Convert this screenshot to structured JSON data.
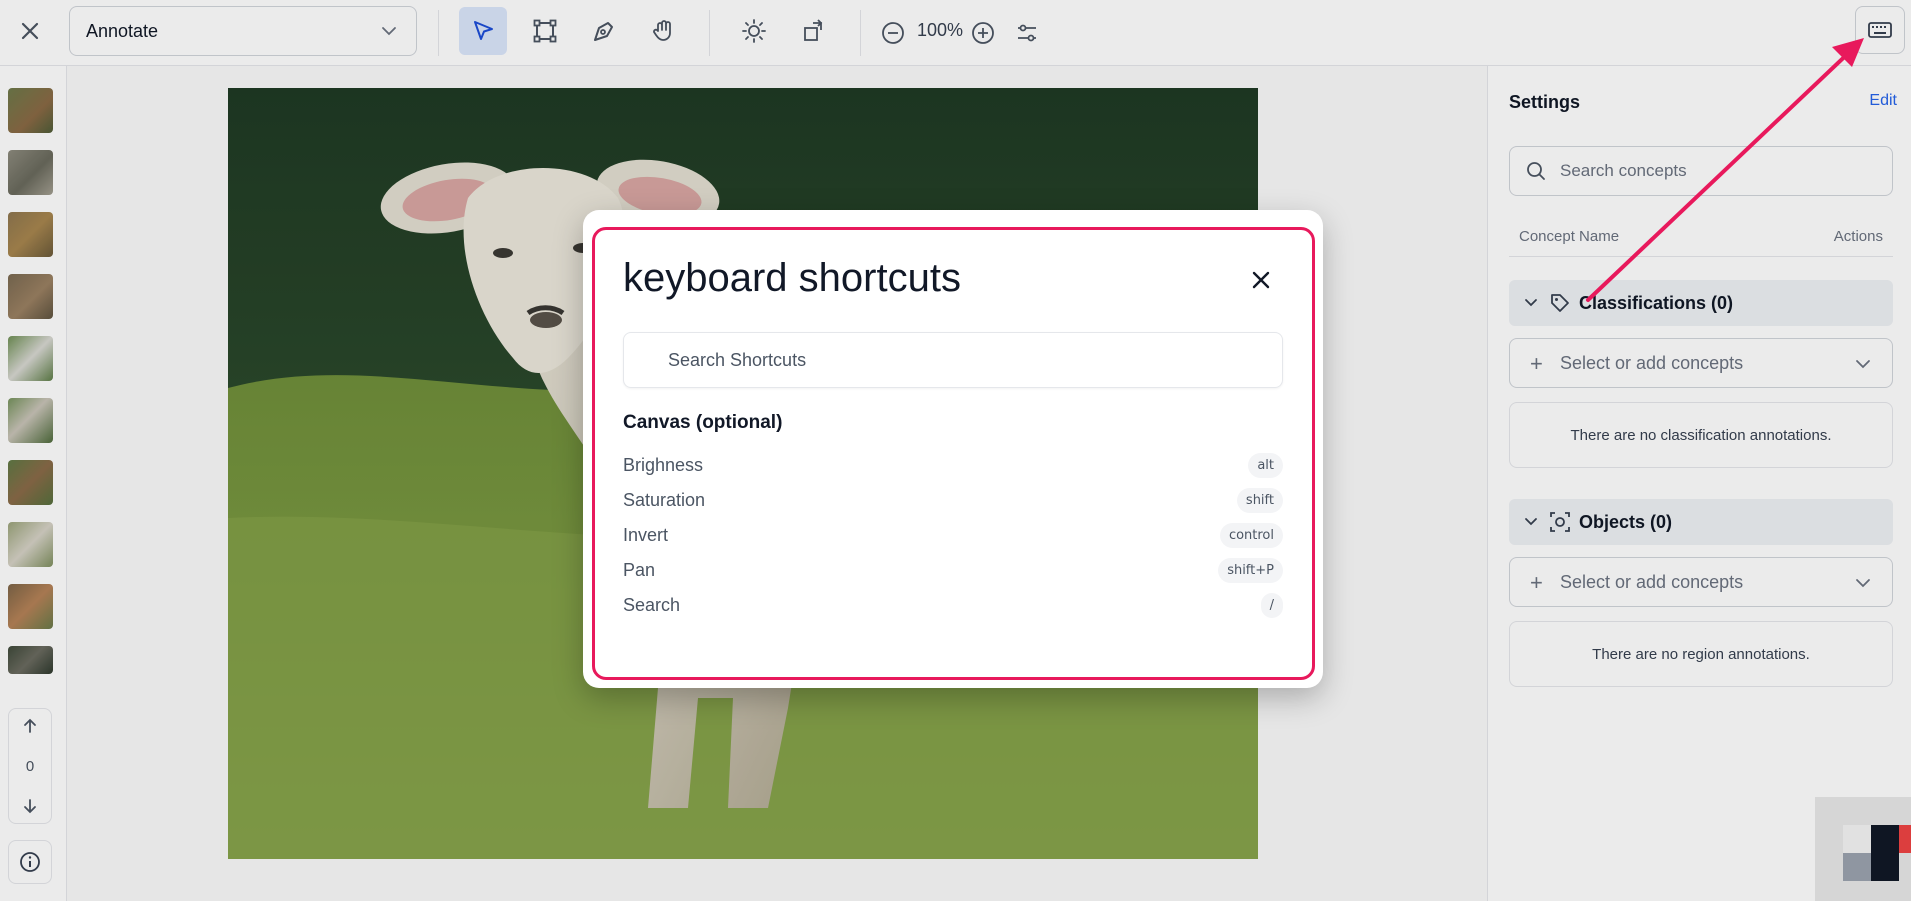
{
  "toolbar": {
    "mode_value": "Annotate",
    "zoom_level": "100%",
    "tools": [
      "select-pointer",
      "bounding-box",
      "polygon-pen",
      "pan-hand"
    ]
  },
  "thumbnails": {
    "count": 10
  },
  "navigator": {
    "index": "0"
  },
  "settings": {
    "title": "Settings",
    "edit_label": "Edit",
    "search_placeholder": "Search concepts",
    "col_concept": "Concept Name",
    "col_actions": "Actions",
    "classifications_label": "Classifications (0)",
    "classifications_add": "Select or add concepts",
    "classifications_empty": "There are no classification annotations.",
    "objects_label": "Objects (0)",
    "objects_add": "Select or add concepts",
    "objects_empty": "There are no region annotations."
  },
  "modal": {
    "title": "keyboard shortcuts",
    "search_placeholder": "Search Shortcuts",
    "group_title": "Canvas (optional)",
    "shortcuts": [
      {
        "label": "Brighness",
        "key": "alt"
      },
      {
        "label": "Saturation",
        "key": "shift"
      },
      {
        "label": "Invert",
        "key": "control"
      },
      {
        "label": "Pan",
        "key": "shift+P"
      },
      {
        "label": "Search",
        "key": "/"
      }
    ]
  },
  "colors": {
    "accent_blue": "#2563eb",
    "highlight_pink": "#e8195c",
    "active_tool_bg": "#dbe6fb"
  }
}
